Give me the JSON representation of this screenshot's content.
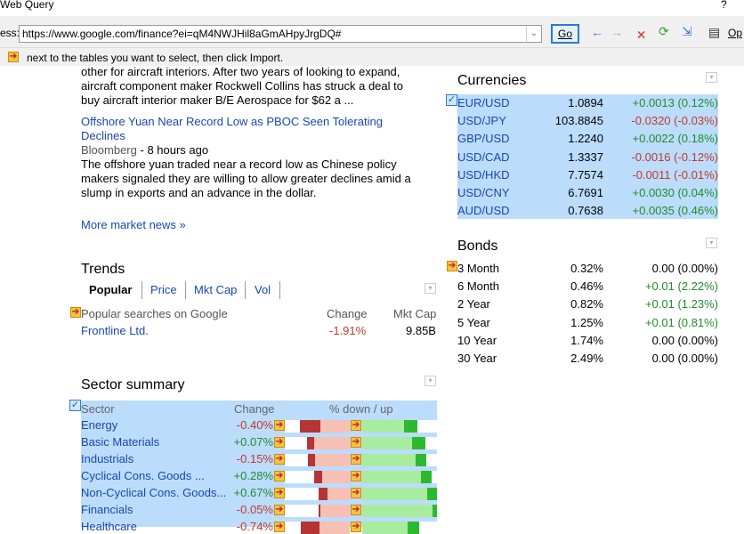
{
  "window": {
    "title": "Web Query",
    "help": "?"
  },
  "toolbar": {
    "address_label": "ess:",
    "address_value": "https://www.google.com/finance?ei=qM4NWJHil8aGmAHpyJrgDQ#",
    "go_label": "Go",
    "options_label": "Op"
  },
  "info": {
    "text": "next to the tables you want to select, then click Import."
  },
  "news": {
    "lead_lines": [
      "other for aircraft interiors. After two years of looking to expand,",
      "aircraft component maker Rockwell Collins has struck a deal to",
      "buy aircraft interior maker B/E Aerospace for $62 a ..."
    ],
    "item": {
      "title_lines": [
        "Offshore Yuan Near Record Low as PBOC Seen Tolerating",
        "Declines"
      ],
      "source": "Bloomberg",
      "time": "- 8 hours ago",
      "body_lines": [
        "The offshore yuan traded near a record low as Chinese policy",
        "makers signaled they are willing to allow greater declines amid a",
        "slump in exports and an advance in the dollar."
      ]
    },
    "more": "More market news »"
  },
  "trends": {
    "title": "Trends",
    "tabs": [
      "Popular",
      "Price",
      "Mkt Cap",
      "Vol"
    ],
    "caption": "Popular searches on Google",
    "col_change": "Change",
    "col_mktcap": "Mkt Cap",
    "rows": [
      {
        "name": "Frontline Ltd.",
        "change": "-1.91%",
        "mktcap": "9.85B"
      }
    ]
  },
  "sectors": {
    "title": "Sector summary",
    "col_sector": "Sector",
    "col_change": "Change",
    "col_range": "% down / up",
    "rows": [
      {
        "name": "Energy",
        "change": "-0.40%",
        "dir": "down",
        "down": [
          0.23,
          0.55
        ],
        "up": [
          0.56,
          0.74
        ]
      },
      {
        "name": "Basic Materials",
        "change": "+0.07%",
        "dir": "up",
        "down": [
          0.34,
          0.45
        ],
        "up": [
          0.67,
          0.85
        ]
      },
      {
        "name": "Industrials",
        "change": "-0.15%",
        "dir": "down",
        "down": [
          0.36,
          0.47
        ],
        "up": [
          0.71,
          0.86
        ]
      },
      {
        "name": "Cyclical Cons. Goods ...",
        "change": "+0.28%",
        "dir": "up",
        "down": [
          0.45,
          0.58
        ],
        "up": [
          0.79,
          0.93
        ]
      },
      {
        "name": "Non-Cyclical Cons. Goods...",
        "change": "+0.67%",
        "dir": "up",
        "down": [
          0.52,
          0.66
        ],
        "up": [
          0.87,
          1.0
        ]
      },
      {
        "name": "Financials",
        "change": "-0.05%",
        "dir": "down",
        "down": [
          0.52,
          0.55
        ],
        "up": [
          0.94,
          1.0
        ]
      },
      {
        "name": "Healthcare",
        "change": "-0.74%",
        "dir": "down",
        "down": [
          0.25,
          0.53
        ],
        "up": [
          0.61,
          0.76
        ]
      }
    ]
  },
  "currencies": {
    "title": "Currencies",
    "rows": [
      {
        "pair": "EUR/USD",
        "price": "1.0894",
        "change": "+0.0013 (0.12%)",
        "dir": "up"
      },
      {
        "pair": "USD/JPY",
        "price": "103.8845",
        "change": "-0.0320 (-0.03%)",
        "dir": "down"
      },
      {
        "pair": "GBP/USD",
        "price": "1.2240",
        "change": "+0.0022 (0.18%)",
        "dir": "up"
      },
      {
        "pair": "USD/CAD",
        "price": "1.3337",
        "change": "-0.0016 (-0.12%)",
        "dir": "down"
      },
      {
        "pair": "USD/HKD",
        "price": "7.7574",
        "change": "-0.0011 (-0.01%)",
        "dir": "down"
      },
      {
        "pair": "USD/CNY",
        "price": "6.7691",
        "change": "+0.0030 (0.04%)",
        "dir": "up"
      },
      {
        "pair": "AUD/USD",
        "price": "0.7638",
        "change": "+0.0035 (0.46%)",
        "dir": "up"
      }
    ]
  },
  "bonds": {
    "title": "Bonds",
    "rows": [
      {
        "term": "3 Month",
        "yield": "0.32%",
        "change": "0.00 (0.00%)",
        "dir": "flat"
      },
      {
        "term": "6 Month",
        "yield": "0.46%",
        "change": "+0.01 (2.22%)",
        "dir": "up"
      },
      {
        "term": "2 Year",
        "yield": "0.82%",
        "change": "+0.01 (1.23%)",
        "dir": "up"
      },
      {
        "term": "5 Year",
        "yield": "1.25%",
        "change": "+0.01 (0.81%)",
        "dir": "up"
      },
      {
        "term": "10 Year",
        "yield": "1.74%",
        "change": "0.00 (0.00%)",
        "dir": "flat"
      },
      {
        "term": "30 Year",
        "yield": "2.49%",
        "change": "0.00 (0.00%)",
        "dir": "flat"
      }
    ]
  }
}
